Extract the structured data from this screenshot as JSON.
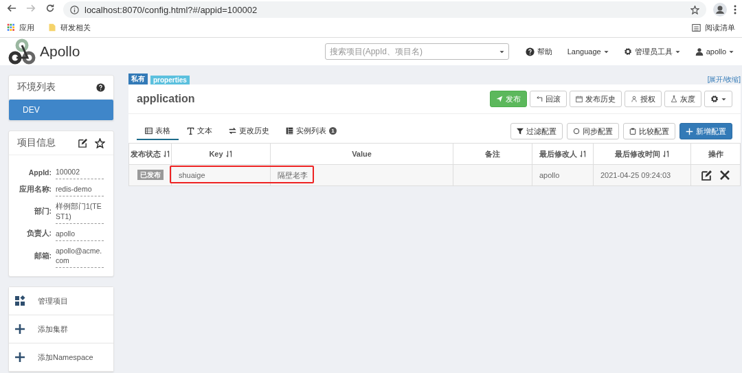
{
  "browser": {
    "url": "localhost:8070/config.html?#/appid=100002",
    "bookmarks": [
      {
        "label": "应用",
        "kind": "apps"
      },
      {
        "label": "研发相关",
        "kind": "folder"
      }
    ],
    "reading_list": "阅读清单"
  },
  "header": {
    "logo": "Apollo",
    "search_placeholder": "搜索项目(AppId、项目名)",
    "nav": [
      {
        "label": "帮助",
        "kind": "help"
      },
      {
        "label": "Language",
        "kind": "dropdown"
      },
      {
        "label": "管理员工具",
        "kind": "gear"
      },
      {
        "label": "apollo",
        "kind": "user"
      }
    ]
  },
  "env_panel": {
    "title": "环境列表",
    "envs": [
      {
        "label": "DEV",
        "selected": true
      }
    ]
  },
  "project_info": {
    "title": "项目信息",
    "fields": [
      {
        "label": "AppId:",
        "value": "100002"
      },
      {
        "label": "应用名称:",
        "value": "redis-demo"
      },
      {
        "label": "部门:",
        "value": "样例部门1(TEST1)"
      },
      {
        "label": "负责人:",
        "value": "apollo"
      },
      {
        "label": "邮箱:",
        "value": "apollo@acme.com"
      }
    ]
  },
  "actions": [
    {
      "label": "管理项目",
      "kind": "grid"
    },
    {
      "label": "添加集群",
      "kind": "plus"
    },
    {
      "label": "添加Namespace",
      "kind": "plus"
    }
  ],
  "namespace": {
    "badges": [
      {
        "label": "私有",
        "color": "#337ab7"
      },
      {
        "label": "properties",
        "color": "#5bc0de"
      }
    ],
    "toggle": "[展开/收缩]",
    "name": "application",
    "buttons": [
      {
        "label": "发布",
        "kind": "publish"
      },
      {
        "label": "回滚",
        "kind": "rollback"
      },
      {
        "label": "发布历史",
        "kind": "history"
      },
      {
        "label": "授权",
        "kind": "auth"
      },
      {
        "label": "灰度",
        "kind": "gray"
      },
      {
        "kind": "settings"
      }
    ],
    "tabs": [
      {
        "label": "表格",
        "kind": "table",
        "selected": true
      },
      {
        "label": "文本",
        "kind": "text",
        "selected": false
      },
      {
        "label": "更改历史",
        "kind": "history",
        "selected": false
      },
      {
        "label": "实例列表",
        "kind": "instances",
        "selected": false,
        "count": "1"
      }
    ],
    "tools": [
      {
        "label": "过滤配置",
        "kind": "filter"
      },
      {
        "label": "同步配置",
        "kind": "sync"
      },
      {
        "label": "比较配置",
        "kind": "compare"
      },
      {
        "label": "新增配置",
        "kind": "add"
      }
    ],
    "columns": [
      {
        "label": "发布状态",
        "sortable": true
      },
      {
        "label": "Key",
        "sortable": true
      },
      {
        "label": "Value",
        "sortable": false
      },
      {
        "label": "备注",
        "sortable": false
      },
      {
        "label": "最后修改人",
        "sortable": true
      },
      {
        "label": "最后修改时间",
        "sortable": true
      },
      {
        "label": "操作",
        "sortable": false
      }
    ],
    "rows": [
      {
        "status": "已发布",
        "key": "shuaige",
        "value": "隔壁老李",
        "modifier": "apollo",
        "time": "2021-04-25 09:24:03",
        "highlighted": true
      }
    ]
  }
}
